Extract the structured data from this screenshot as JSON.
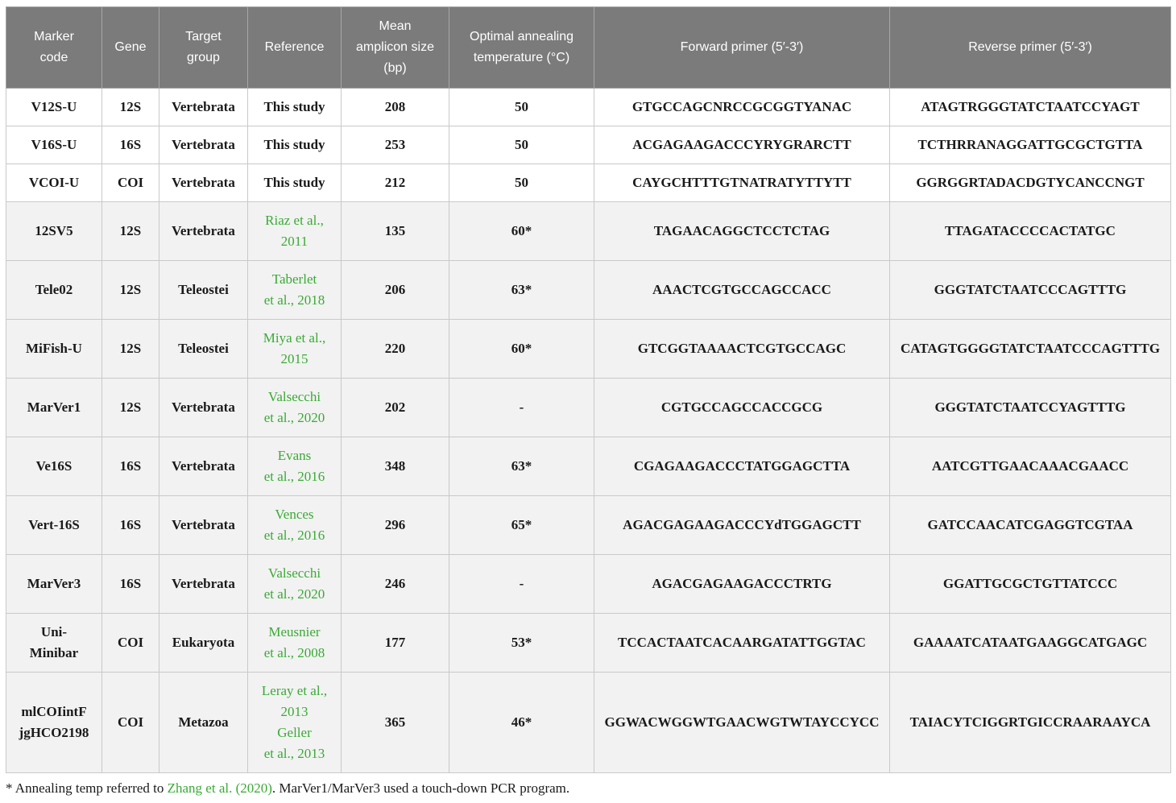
{
  "colors": {
    "header_bg": "#7b7b7b",
    "link": "#3aaa35",
    "shaded_row": "#f2f2f2"
  },
  "table": {
    "headers": [
      "Marker\ncode",
      "Gene",
      "Target\ngroup",
      "Reference",
      "Mean\namplicon size\n(bp)",
      "Optimal annealing\ntemperature (°C)",
      "Forward primer (5′-3′)",
      "Reverse primer (5′-3′)"
    ],
    "rows": [
      {
        "code": "V12S-U",
        "gene": "12S",
        "target": "Vertebrata",
        "reference": "This study",
        "ref_link": false,
        "size": "208",
        "temp": "50",
        "forward": "GTGCCAGCNRCCGCGGTYANAC",
        "reverse": "ATAGTRGGGTATCTAATCCYAGT",
        "shaded": false
      },
      {
        "code": "V16S-U",
        "gene": "16S",
        "target": "Vertebrata",
        "reference": "This study",
        "ref_link": false,
        "size": "253",
        "temp": "50",
        "forward": "ACGAGAAGACCCYRYGRARCTT",
        "reverse": "TCTHRRANAGGATTGCGCTGTTA",
        "shaded": false
      },
      {
        "code": "VCOI-U",
        "gene": "COI",
        "target": "Vertebrata",
        "reference": "This study",
        "ref_link": false,
        "size": "212",
        "temp": "50",
        "forward": "CAYGCHTTTGTNATRATYTTYTT",
        "reverse": "GGRGGRTADACDGTYCANCCNGT",
        "shaded": false
      },
      {
        "code": "12SV5",
        "gene": "12S",
        "target": "Vertebrata",
        "reference": "Riaz et al.,\n2011",
        "ref_link": true,
        "size": "135",
        "temp": "60*",
        "forward": "TAGAACAGGCTCCTCTAG",
        "reverse": "TTAGATACCCCACTATGC",
        "shaded": true
      },
      {
        "code": "Tele02",
        "gene": "12S",
        "target": "Teleostei",
        "reference": "Taberlet\net al., 2018",
        "ref_link": true,
        "size": "206",
        "temp": "63*",
        "forward": "AAACTCGTGCCAGCCACC",
        "reverse": "GGGTATCTAATCCCAGTTTG",
        "shaded": true
      },
      {
        "code": "MiFish-U",
        "gene": "12S",
        "target": "Teleostei",
        "reference": "Miya et al.,\n2015",
        "ref_link": true,
        "size": "220",
        "temp": "60*",
        "forward": "GTCGGTAAAACTCGTGCCAGC",
        "reverse": "CATAGTGGGGTATCTAATCCCAGTTTG",
        "shaded": true
      },
      {
        "code": "MarVer1",
        "gene": "12S",
        "target": "Vertebrata",
        "reference": "Valsecchi\net al., 2020",
        "ref_link": true,
        "size": "202",
        "temp": "-",
        "forward": "CGTGCCAGCCACCGCG",
        "reverse": "GGGTATCTAATCCYAGTTTG",
        "shaded": true
      },
      {
        "code": "Ve16S",
        "gene": "16S",
        "target": "Vertebrata",
        "reference": "Evans\net al., 2016",
        "ref_link": true,
        "size": "348",
        "temp": "63*",
        "forward": "CGAGAAGACCCTATGGAGCTTA",
        "reverse": "AATCGTTGAACAAACGAACC",
        "shaded": true
      },
      {
        "code": "Vert-16S",
        "gene": "16S",
        "target": "Vertebrata",
        "reference": "Vences\net al., 2016",
        "ref_link": true,
        "size": "296",
        "temp": "65*",
        "forward": "AGACGAGAAGACCCYdTGGAGCTT",
        "reverse": "GATCCAACATCGAGGTCGTAA",
        "shaded": true
      },
      {
        "code": "MarVer3",
        "gene": "16S",
        "target": "Vertebrata",
        "reference": "Valsecchi\net al., 2020",
        "ref_link": true,
        "size": "246",
        "temp": "-",
        "forward": "AGACGAGAAGACCCTRTG",
        "reverse": "GGATTGCGCTGTTATCCC",
        "shaded": true
      },
      {
        "code": "Uni-\nMinibar",
        "gene": "COI",
        "target": "Eukaryota",
        "reference": "Meusnier\net al., 2008",
        "ref_link": true,
        "size": "177",
        "temp": "53*",
        "forward": "TCCACTAATCACAARGATATTGGTAC",
        "reverse": "GAAAATCATAATGAAGGCATGAGC",
        "shaded": true
      },
      {
        "code": "mlCOIintF\njgHCO2198",
        "gene": "COI",
        "target": "Metazoa",
        "reference": "Leray et al.,\n2013\nGeller\net al., 2013",
        "ref_link": true,
        "size": "365",
        "temp": "46*",
        "forward": "GGWACWGGWTGAACWGTWTAYCCYCC",
        "reverse": "TAIACYTCIGGRTGICCRAARAAYCA",
        "shaded": true
      }
    ]
  },
  "footnote": {
    "prefix": "* Annealing temp referred to ",
    "link": "Zhang et al. (2020)",
    "suffix": ". MarVer1/MarVer3 used a touch-down PCR program."
  }
}
